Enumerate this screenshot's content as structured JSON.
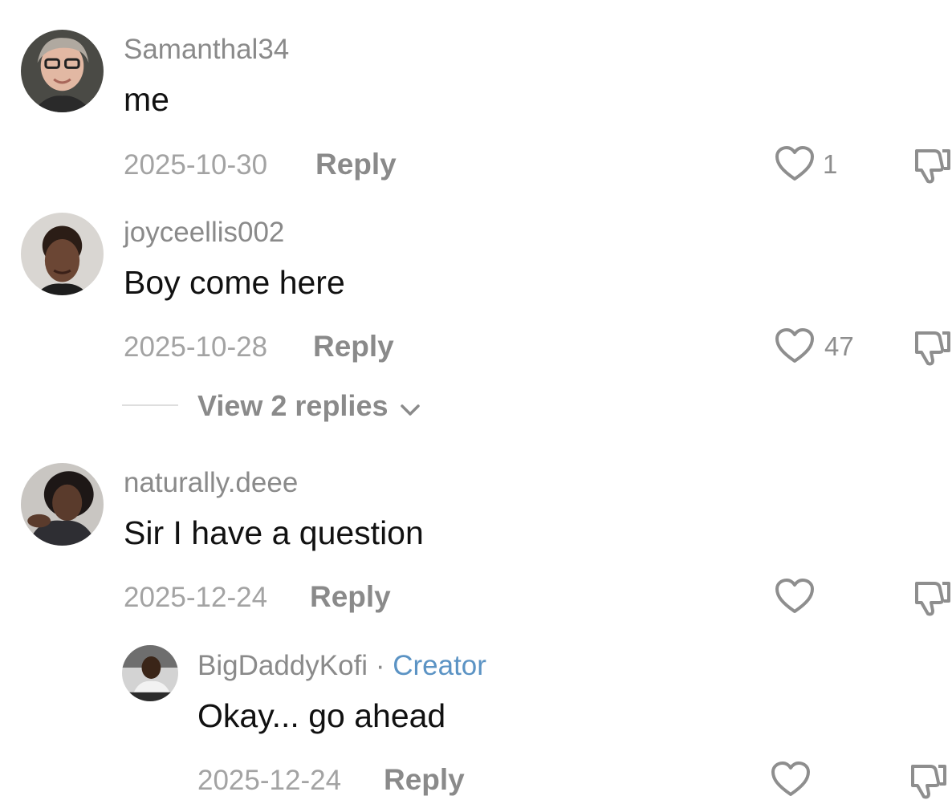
{
  "comments": [
    {
      "username": "Samanthal34",
      "text": "me",
      "date": "2025-10-30",
      "reply_label": "Reply",
      "likes": "1",
      "like_icon": "heart-outline-icon",
      "dislike_icon": "thumbs-down-icon"
    },
    {
      "username": "joyceellis002",
      "text": "Boy come here",
      "date": "2025-10-28",
      "reply_label": "Reply",
      "likes": "47",
      "like_icon": "heart-outline-icon",
      "dislike_icon": "thumbs-down-icon",
      "view_replies": "View 2 replies"
    },
    {
      "username": "naturally.deee",
      "text": "Sir I have a question",
      "date": "2025-12-24",
      "reply_label": "Reply",
      "likes": "",
      "like_icon": "heart-outline-icon",
      "dislike_icon": "thumbs-down-icon",
      "replies": [
        {
          "username": "BigDaddyKofi",
          "separator": "·",
          "badge": "Creator",
          "text": "Okay... go ahead",
          "date": "2025-12-24",
          "reply_label": "Reply",
          "likes": "",
          "like_icon": "heart-outline-icon",
          "dislike_icon": "thumbs-down-icon"
        }
      ]
    }
  ],
  "colors": {
    "username": "#8a8a8a",
    "text": "#111111",
    "date": "#a3a3a3",
    "creator": "#5b93c4",
    "icon": "#8e8e8e"
  }
}
